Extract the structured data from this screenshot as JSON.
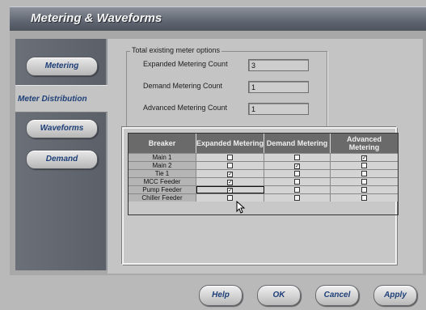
{
  "window": {
    "title": "Metering & Waveforms"
  },
  "sidebar": {
    "items": [
      {
        "label": "Metering",
        "active": false
      },
      {
        "label": "Meter Distribution",
        "active": true
      },
      {
        "label": "Waveforms",
        "active": false
      },
      {
        "label": "Demand",
        "active": false
      }
    ]
  },
  "options": {
    "legend": "Total existing meter options",
    "fields": [
      {
        "label": "Expanded Metering Count",
        "value": "3"
      },
      {
        "label": "Demand Metering Count",
        "value": "1"
      },
      {
        "label": "Advanced Metering Count",
        "value": "1"
      }
    ]
  },
  "table": {
    "headers": [
      "Breaker",
      "Expanded Metering",
      "Demand Metering",
      "Advanced Metering"
    ],
    "rows": [
      {
        "breaker": "Main 1",
        "expanded": false,
        "demand": false,
        "advanced": true
      },
      {
        "breaker": "Main 2",
        "expanded": false,
        "demand": true,
        "advanced": false
      },
      {
        "breaker": "Tie 1",
        "expanded": true,
        "demand": false,
        "advanced": false
      },
      {
        "breaker": "MCC Feeder",
        "expanded": true,
        "demand": false,
        "advanced": false
      },
      {
        "breaker": "Pump Feeder",
        "expanded": true,
        "demand": false,
        "advanced": false
      },
      {
        "breaker": "Chiller Feeder",
        "expanded": false,
        "demand": false,
        "advanced": false
      }
    ]
  },
  "buttons": {
    "help": "Help",
    "ok": "OK",
    "cancel": "Cancel",
    "apply": "Apply"
  },
  "colors": {
    "accent_text": "#1e3f78",
    "title_bar": "#5f6570",
    "header": "#6a6a6a"
  },
  "icons": {
    "checkmark": "check-icon",
    "cursor": "mouse-pointer-icon"
  }
}
